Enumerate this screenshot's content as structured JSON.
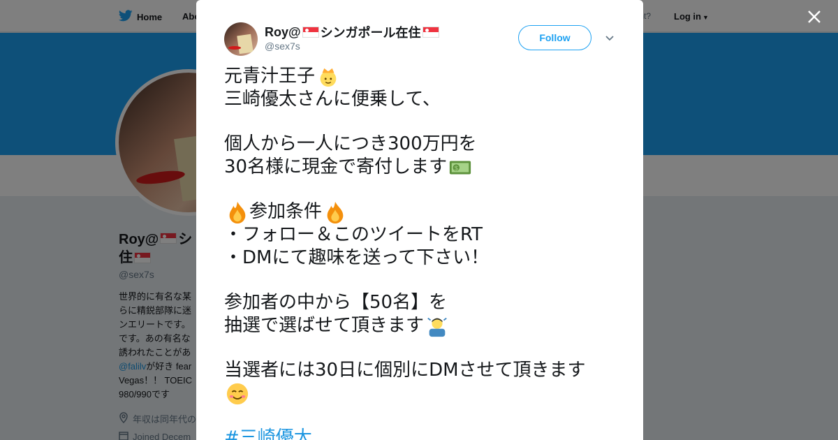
{
  "topnav": {
    "home_label": "Home",
    "about_label": "Abo",
    "account_prompt": "ccount?",
    "login_label": "Log in"
  },
  "background_profile": {
    "name_line1": "Roy@",
    "name_part2": "シ",
    "name_line2": "住",
    "handle": "@sex7s",
    "bio_lines": [
      "世界的に有名な某",
      "らに精鋭部隊に迷",
      "ンエリートです。",
      "です。あの有名な",
      "誘われたことがあ"
    ],
    "bio_mention": "@falilv",
    "bio_mention_suffix": "が好き fear",
    "bio_line7": "Vegas！！ TOEIC",
    "bio_line8": "980/990です",
    "location": "年収は同年代の",
    "joined": "Joined Decem"
  },
  "tweet": {
    "user_name": "Roy@",
    "user_name_suffix": "シンガポール在住",
    "user_handle": "@sex7s",
    "follow_label": "Follow",
    "lines": {
      "l1": "元青汁王子",
      "l2": "三崎優太さんに便乗して、",
      "l3": "個人から一人につき300万円を",
      "l4": "30名様に現金で寄付します",
      "l5": "参加条件",
      "l6": "・フォロー＆このツイートをRT",
      "l7": "・DMにて趣味を送って下さい！",
      "l8": "参加者の中から【50名】を",
      "l9": "抽選で選ばせて頂きます",
      "l10": "当選者には30日に個別にDMさせて頂きます",
      "hashtag": "#三崎優太"
    }
  },
  "colors": {
    "brand": "#1da1f2",
    "link": "#1b95e0",
    "text": "#14171a",
    "muted": "#657786"
  },
  "icons": [
    "twitter-bird-icon",
    "close-icon",
    "chevron-down-icon",
    "singapore-flag-icon",
    "prince-emoji-icon",
    "money-emoji-icon",
    "fire-emoji-icon",
    "bowing-person-emoji-icon",
    "smiling-face-emoji-icon",
    "location-icon",
    "calendar-icon"
  ]
}
